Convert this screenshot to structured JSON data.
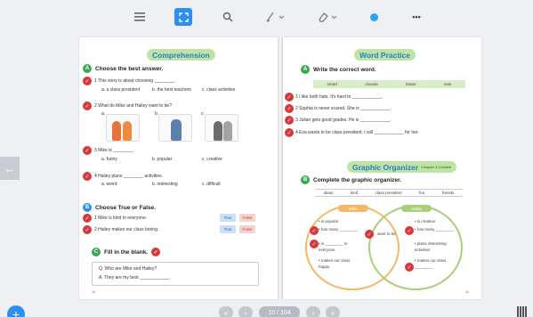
{
  "toolbar": {
    "icons": [
      "list-icon",
      "fullscreen-icon",
      "zoom-icon",
      "pen-icon",
      "eraser-icon",
      "color-dot-icon",
      "more-icon"
    ],
    "more_label": "•••"
  },
  "pager": {
    "count_label": "10 / 104"
  },
  "left_page": {
    "banner": "Comprehension",
    "secA": {
      "badge": "A",
      "title": "Choose the best answer."
    },
    "q1": {
      "text": "1  This story is about choosing ________.",
      "a": "a. a class president",
      "b": "b. the best teachers",
      "c": "c. class activities"
    },
    "q2": {
      "text": "2  What do Mike and Hailey want to be?",
      "a": "a.",
      "b": "b.",
      "c": "c."
    },
    "q3": {
      "text": "3  Mike is ________.",
      "a": "a. funny",
      "b": "b. popular",
      "c": "c. creative"
    },
    "q4": {
      "text": "4  Hailey plans ________ activities.",
      "a": "a. weird",
      "b": "b. interesting",
      "c": "c. difficult"
    },
    "secB": {
      "badge": "B",
      "title": "Choose True or False."
    },
    "tf1": "1  Mike is kind to everyone.",
    "tf2": "2  Hailey makes our class boring.",
    "true_label": "True",
    "false_label": "False",
    "secC": {
      "badge": "C",
      "title": "Fill in the blank."
    },
    "fill_q": "Q. Who are Mike and Hailey?",
    "fill_a": "A. They are my best ____________.",
    "page_num": "10"
  },
  "right_page": {
    "banner": "Word Practice",
    "secA": {
      "title": "Write the correct word."
    },
    "words": [
      "smart",
      "choose",
      "brave",
      "vote"
    ],
    "w1": "1  I like both hats. It's hard to ____________.",
    "w2": "2  Sophia is never scared. She is ____________.",
    "w3": "3  Julian gets good grades. He is ____________.",
    "w4": "4  Eva wants to be class president. I will ____________ for her.",
    "banner2": "Graphic Organizer",
    "banner2_sub": "Compare & Contrast",
    "secB": {
      "title": "Complete the graphic organizer."
    },
    "words2": [
      "ideas",
      "kind",
      "class president",
      "fun",
      "friends"
    ],
    "venn_left_head": "Mike",
    "venn_right_head": "Hailey",
    "left_items": [
      "• is popular",
      "• has many ________",
      "• is ________ to",
      "  everyone",
      "• makes our class",
      "  happy"
    ],
    "center_text": "want to be",
    "right_items": [
      "• is creative",
      "• has many ________",
      "• plans interesting",
      "  activities",
      "• makes our class",
      "  ________"
    ],
    "page_num": "11"
  }
}
